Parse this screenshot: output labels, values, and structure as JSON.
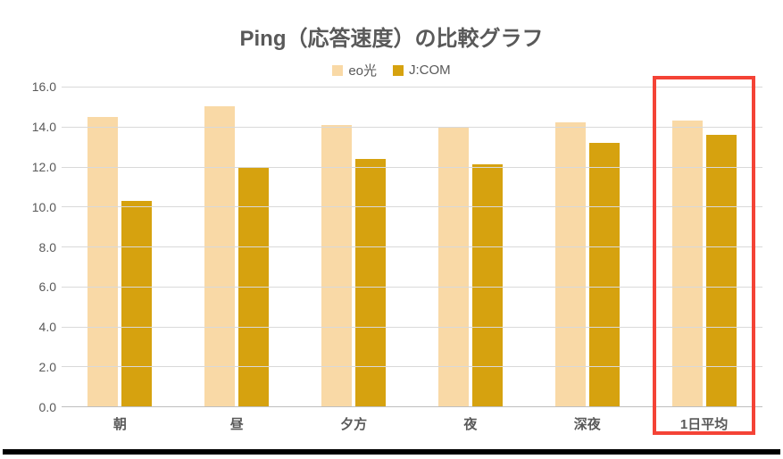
{
  "chart_data": {
    "type": "bar",
    "title": "Ping（応答速度）の比較グラフ",
    "xlabel": "",
    "ylabel": "",
    "ylim": [
      0,
      16
    ],
    "y_ticks": [
      "0.0",
      "2.0",
      "4.0",
      "6.0",
      "8.0",
      "10.0",
      "12.0",
      "14.0",
      "16.0"
    ],
    "categories": [
      "朝",
      "昼",
      "夕方",
      "夜",
      "深夜",
      "1日平均"
    ],
    "series": [
      {
        "name": "eo光",
        "color": "#f9d9a6",
        "values": [
          14.5,
          15.0,
          14.1,
          14.0,
          14.2,
          14.3
        ]
      },
      {
        "name": "J:COM",
        "color": "#d6a20f",
        "values": [
          10.3,
          12.0,
          12.4,
          12.1,
          13.2,
          13.6
        ]
      }
    ],
    "highlight_category": "1日平均"
  }
}
